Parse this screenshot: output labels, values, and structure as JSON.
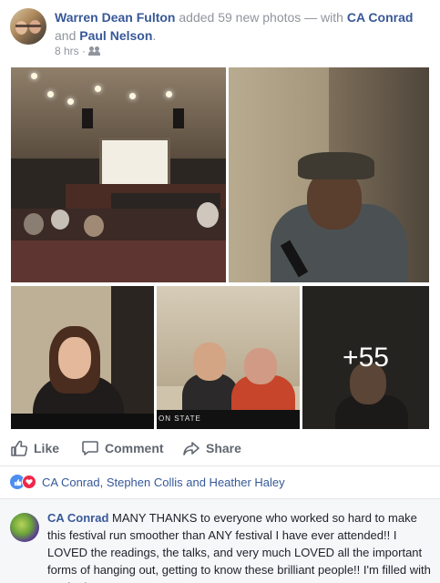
{
  "post": {
    "author": "Warren Dean Fulton",
    "action_text": " added 59 new photos — with ",
    "tagged1": "CA Conrad",
    "and_text": " and ",
    "tagged2": "Paul Nelson",
    "period": ".",
    "time": "8 hrs · ",
    "privacy_icon": "friends-icon"
  },
  "photos": {
    "p4_plaque": "ON STATE",
    "more_count": "+55"
  },
  "actions": {
    "like": "Like",
    "comment": "Comment",
    "share": "Share"
  },
  "reactions": {
    "names": "CA Conrad, Stephen Collis and Heather Haley",
    "colors": {
      "like": "#4d8ef0",
      "love": "#f0284a"
    }
  },
  "comment": {
    "author": "CA Conrad",
    "text": " MANY THANKS to everyone who worked so hard to make this festival run smoother than ANY festival I have ever attended!! I LOVED the readings, the talks, and very much LOVED all the important forms of hanging out, getting to know these brilliant people!! I'm filled with gratitude!!"
  },
  "theme": {
    "link": "#385898",
    "meta": "#90949c",
    "action": "#606770"
  }
}
